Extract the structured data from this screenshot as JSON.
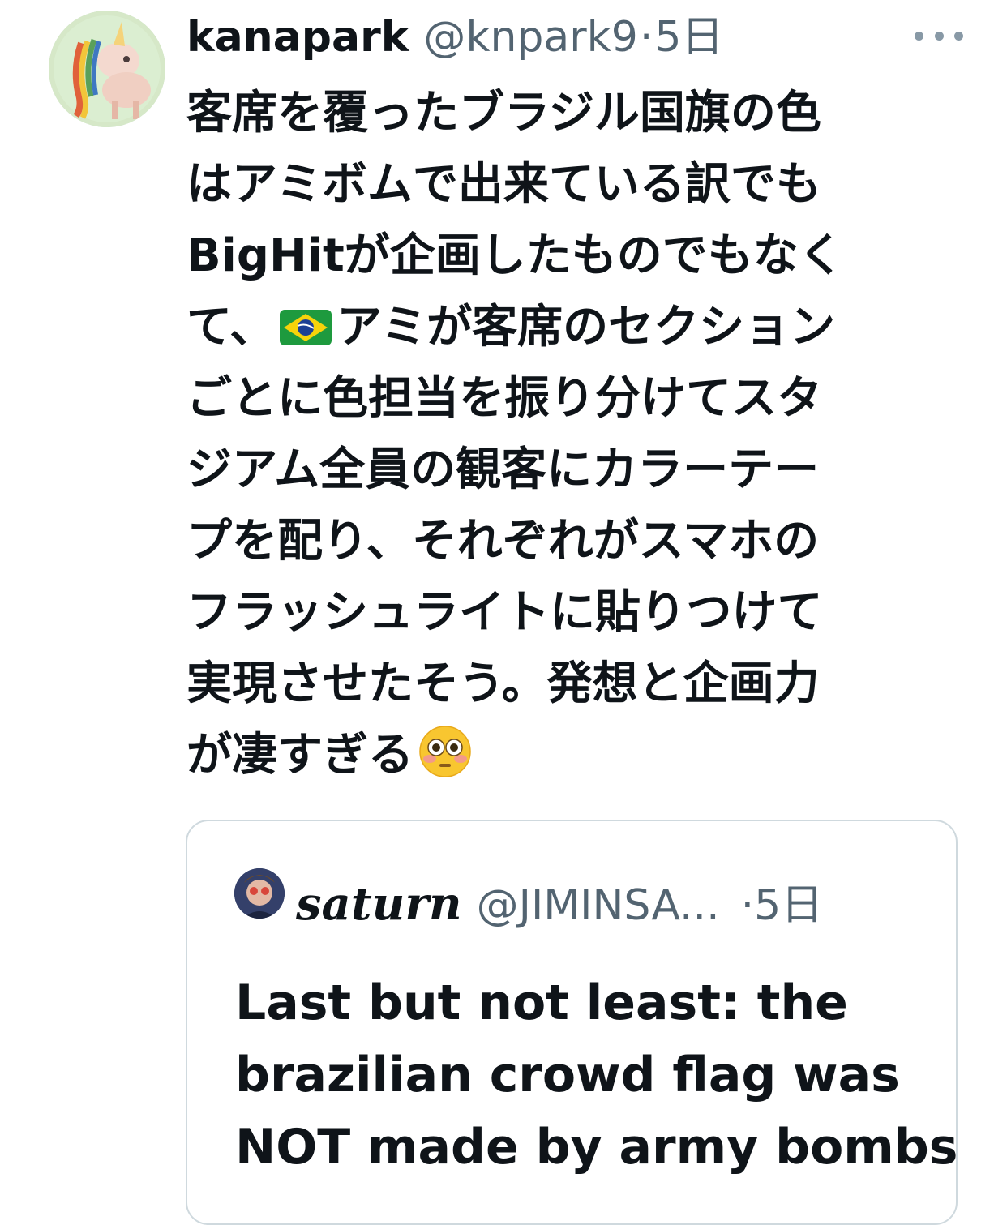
{
  "tweet": {
    "display_name": "kanapark",
    "handle": "@knpark9",
    "separator": "·",
    "time": "5日",
    "text_lines": [
      "客席を覆ったブラジル国旗の色",
      "はアミボムで出来ている訳でも",
      "BigHitが企画したものでもなく",
      "て、",
      "アミが客席のセクション",
      "ごとに色担当を振り分けてスタ",
      "ジアム全員の観客にカラーテー",
      "プを配り、それぞれがスマホの",
      "フラッシュライトに貼りつけて",
      "実現させたそう。発想と企画力",
      "が凄すぎる"
    ],
    "icons": {
      "more": "more-horizontal-icon",
      "flag_emoji": "brazil-flag-emoji",
      "face_emoji": "flushed-face-emoji"
    }
  },
  "quote": {
    "display_name": "saturn",
    "handle": "@JIMINSA...",
    "separator": "·",
    "time": "5日",
    "text_lines": [
      "Last but not least: the",
      "brazilian crowd flag was",
      "NOT made by army bombs"
    ]
  },
  "colors": {
    "text_primary": "#0f1419",
    "text_secondary": "#536471",
    "border": "#cfd9de"
  }
}
